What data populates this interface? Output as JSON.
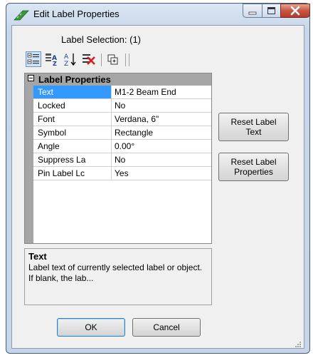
{
  "window": {
    "title": "Edit Label Properties",
    "icons": {
      "app": "measure-icon",
      "minimize": "minimize-icon",
      "maximize": "maximize-icon",
      "close": "close-icon"
    }
  },
  "selection_label": "Label Selection: (1)",
  "toolbar": {
    "items": [
      "categorized-icon",
      "property-pages-icon",
      "alphabetical-sort-icon",
      "delete-icon",
      "copy-icon"
    ]
  },
  "grid": {
    "category": "Label Properties",
    "rows": [
      {
        "key": "Text",
        "value": "M1-2 Beam End"
      },
      {
        "key": "Locked",
        "value": "No"
      },
      {
        "key": "Font",
        "value": "Verdana, 6\""
      },
      {
        "key": "Symbol",
        "value": "Rectangle"
      },
      {
        "key": "Angle",
        "value": "0.00°"
      },
      {
        "key": "Suppress La",
        "value": "No"
      },
      {
        "key": "Pin Label Lc",
        "value": "Yes"
      }
    ]
  },
  "buttons": {
    "reset_text_line1": "Reset Label",
    "reset_text_line2": "Text",
    "reset_props_line1": "Reset Label",
    "reset_props_line2": "Properties",
    "ok": "OK",
    "cancel": "Cancel"
  },
  "description": {
    "title": "Text",
    "body": "Label text of currently selected label or object. If blank, the lab..."
  },
  "colors": {
    "selection": "#3399ff",
    "gutter": "#a5a5a5",
    "close_button": "#c75643"
  }
}
